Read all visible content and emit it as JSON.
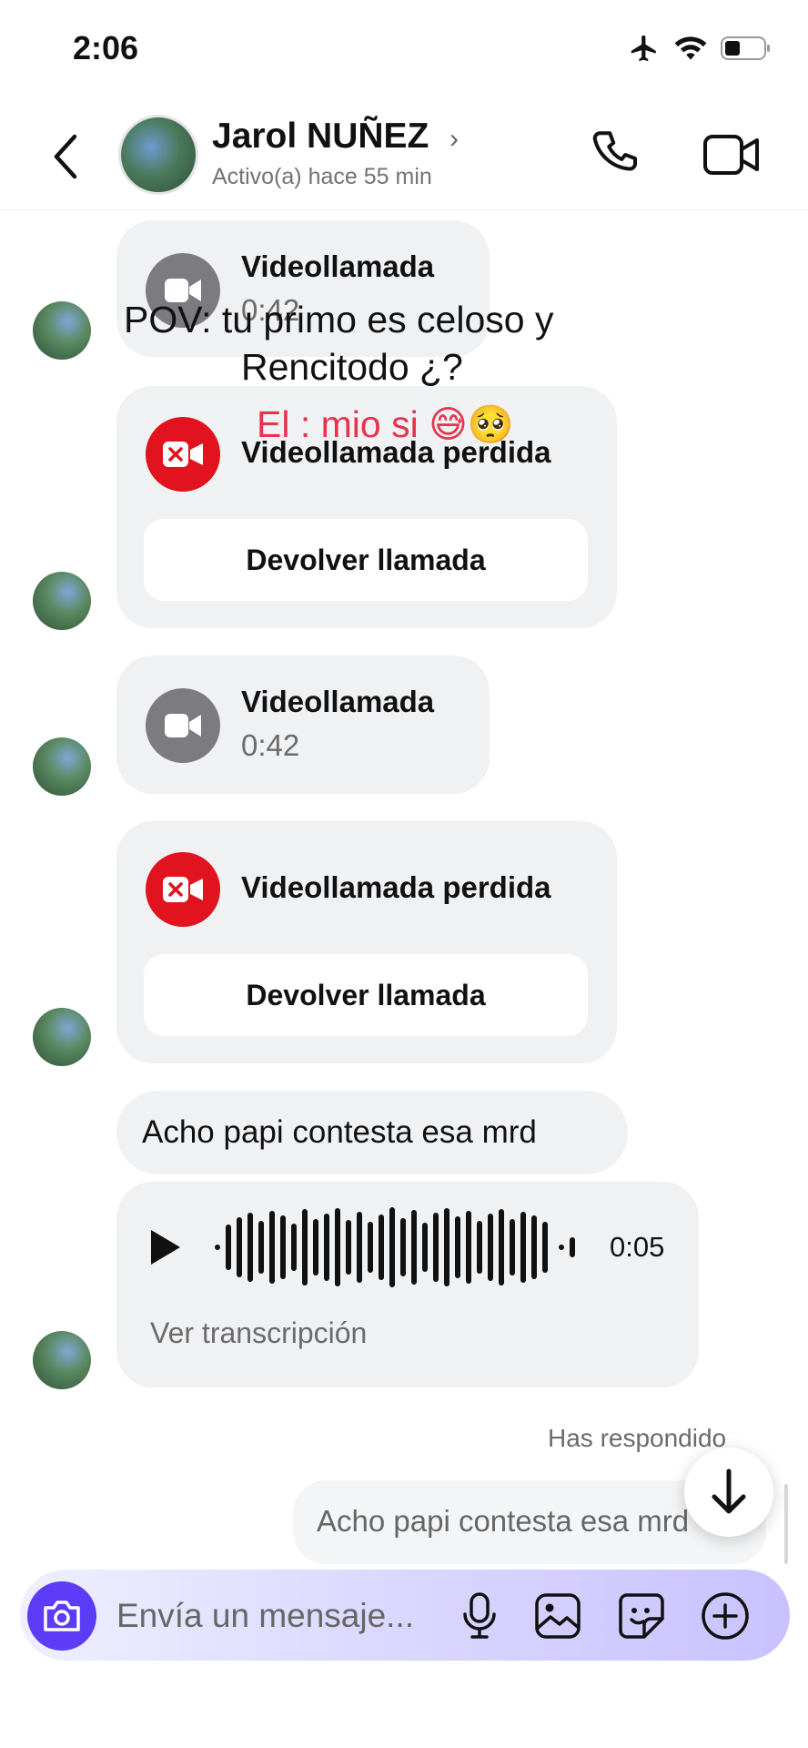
{
  "status_bar": {
    "time": "2:06"
  },
  "header": {
    "contact_name": "Jarol NUÑEZ",
    "chevron": "›",
    "contact_status": "Activo(a) hace 55 min",
    "icons": [
      "back-arrow-icon",
      "phone-icon",
      "video-camera-icon"
    ]
  },
  "overlay": {
    "line1": "POV: tu primo es celoso y",
    "line2": "Rencitodo ¿?",
    "line3": "El : mio si 😅🥺"
  },
  "messages": {
    "call1": {
      "title": "Videollamada",
      "duration": "0:42"
    },
    "missed1": {
      "title": "Videollamada perdida",
      "button": "Devolver llamada"
    },
    "call2": {
      "title": "Videollamada",
      "duration": "0:42"
    },
    "missed2": {
      "title": "Videollamada perdida",
      "button": "Devolver llamada"
    },
    "text1": "Acho papi contesta esa mrd",
    "audio": {
      "duration": "0:05",
      "transcript_link": "Ver transcripción"
    },
    "reply_label": "Has respondido",
    "reply_text": "Acho papi contesta esa mrd"
  },
  "composer": {
    "placeholder": "Envía un mensaje...",
    "icons": [
      "camera-icon",
      "microphone-icon",
      "image-icon",
      "sticker-icon",
      "plus-icon"
    ]
  },
  "colors": {
    "accent": "#5d3cf7",
    "missed": "#e0131f",
    "bubble": "#f0f1f3"
  }
}
